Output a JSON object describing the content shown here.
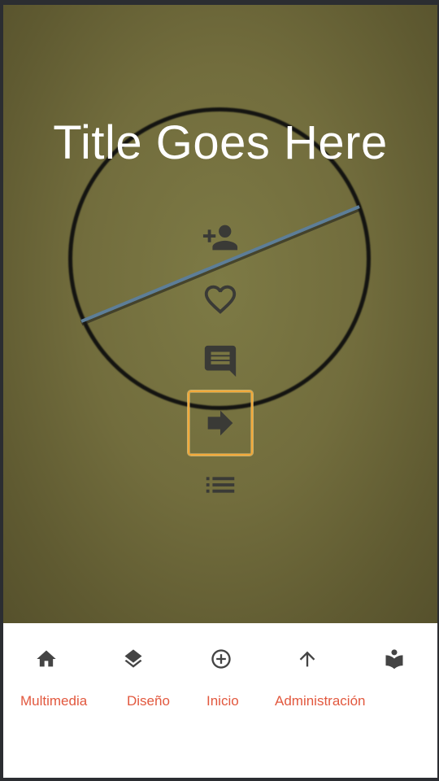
{
  "hero": {
    "title": "Title Goes Here"
  },
  "actions": [
    {
      "icon": "add-person-icon"
    },
    {
      "icon": "heart-icon"
    },
    {
      "icon": "comment-icon"
    },
    {
      "icon": "forward-arrow-icon",
      "focused": true
    },
    {
      "icon": "list-icon"
    }
  ],
  "bottom_nav": {
    "icons": [
      "home-icon",
      "layers-icon",
      "add-circle-icon",
      "arrow-up-icon",
      "reader-icon"
    ],
    "labels": [
      "Multimedia",
      "Diseño",
      "Inicio",
      "Administración"
    ]
  },
  "colors": {
    "label": "#e2583e",
    "icon": "#444444",
    "focus_ring": "#f2a93a",
    "hero_bg": "#726d3d"
  }
}
